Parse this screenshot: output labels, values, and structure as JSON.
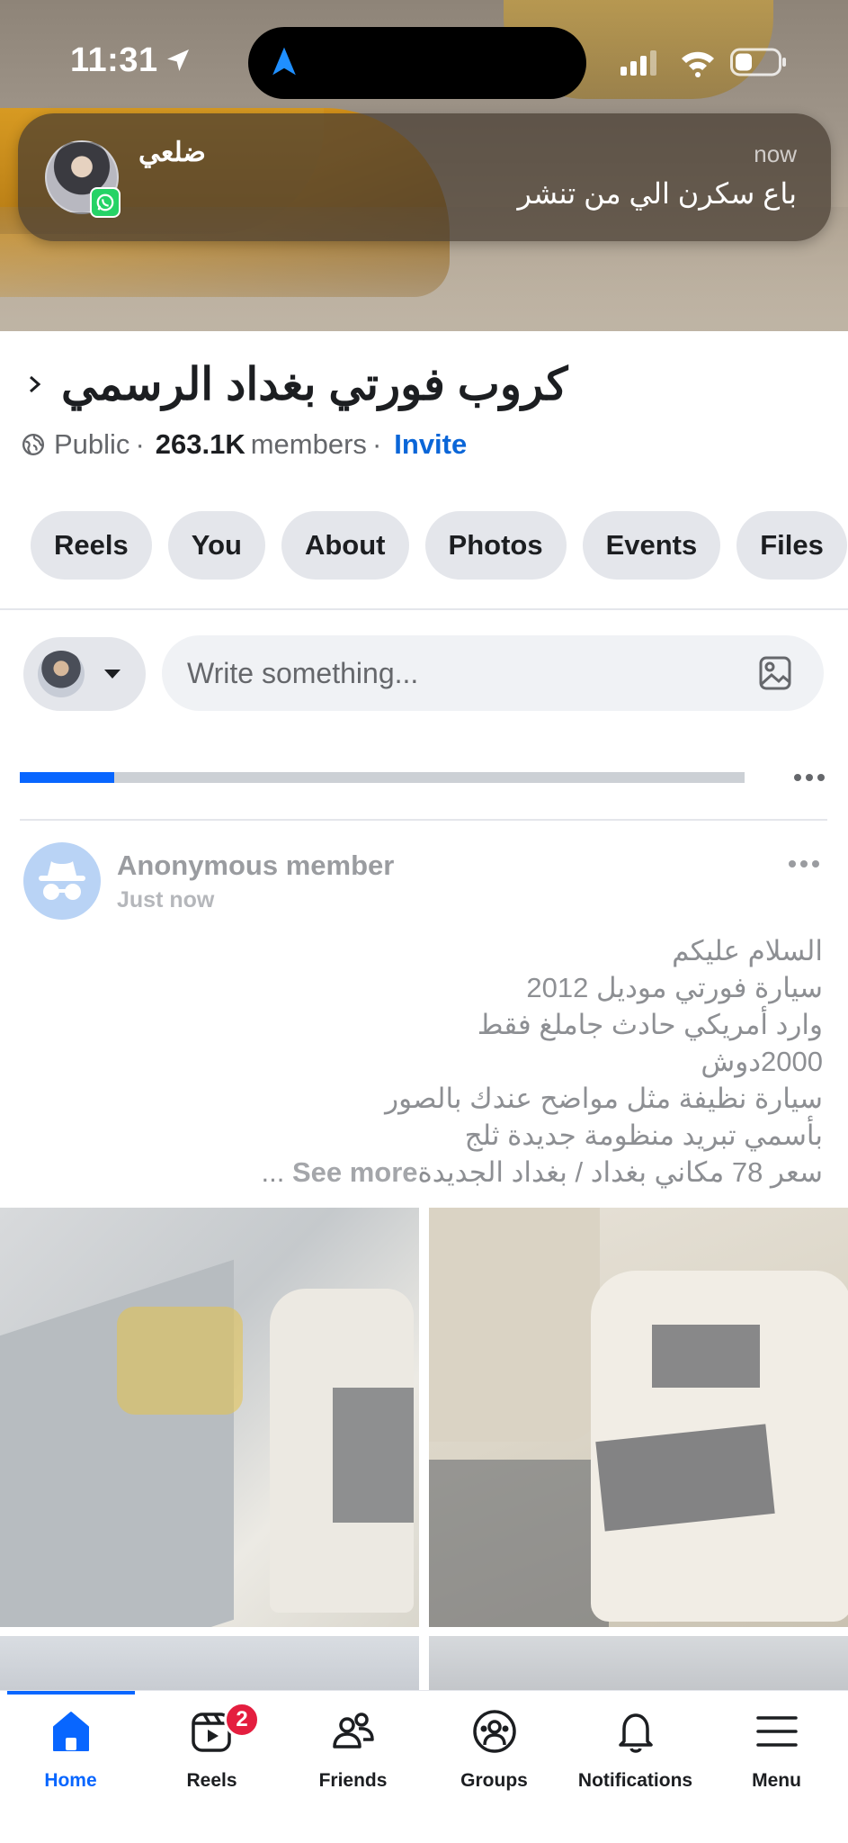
{
  "status_bar": {
    "time": "11:31"
  },
  "notification": {
    "sender": "ضلعي",
    "time": "now",
    "message": "باع سكرن الي من تنشر",
    "app_icon": "whatsapp-icon"
  },
  "group": {
    "title": "كروب فورتي بغداد الرسمي",
    "privacy": "Public",
    "members_count": "263.1K",
    "members_label": "members",
    "separator": "·",
    "invite_label": "Invite"
  },
  "tabs": [
    {
      "label": "Reels"
    },
    {
      "label": "You"
    },
    {
      "label": "About"
    },
    {
      "label": "Photos"
    },
    {
      "label": "Events"
    },
    {
      "label": "Files"
    }
  ],
  "composer": {
    "placeholder": "Write something..."
  },
  "upload": {
    "progress_fraction": 0.13
  },
  "post": {
    "author": "Anonymous member",
    "time": "Just now",
    "lines": [
      "السلام عليكم",
      "سيارة فورتي موديل 2012",
      "وارد أمريكي حادث جاملغ فقط",
      "2000دوش",
      "سيارة نظيفة مثل مواضح عندك بالصور",
      "بأسمي تبريد منظومة جديدة ثلج"
    ],
    "last_line": "سعر 78 مكاني بغداد / بغداد الجديدة",
    "see_more": "See more",
    "ellipsis": "..."
  },
  "nav": {
    "items": [
      {
        "label": "Home",
        "icon": "home-icon",
        "active": true
      },
      {
        "label": "Reels",
        "icon": "reels-icon",
        "badge": "2"
      },
      {
        "label": "Friends",
        "icon": "friends-icon"
      },
      {
        "label": "Groups",
        "icon": "groups-icon"
      },
      {
        "label": "Notifications",
        "icon": "bell-icon"
      },
      {
        "label": "Menu",
        "icon": "menu-icon"
      }
    ]
  },
  "colors": {
    "accent": "#0866ff",
    "invite": "#0a66d8",
    "badge": "#e41e3f"
  }
}
